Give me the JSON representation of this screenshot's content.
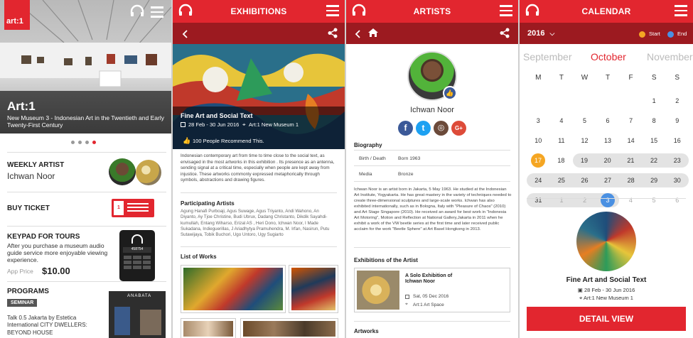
{
  "home": {
    "logo": "art:1",
    "hero_title": "Art:1",
    "hero_sub": "New Museum 3 - Indonesian Art in the Twentieth and Early Twenty-First Century",
    "weekly_label": "WEEKLY ARTIST",
    "weekly_name": "Ichwan Noor",
    "buy_ticket": "BUY TICKET",
    "keypad_title": "KEYPAD FOR TOURS",
    "keypad_desc": "After you purchase a museum audio guide service more enjoyable viewing experience.",
    "app_price_label": "App Price",
    "app_price": "$10.00",
    "phone_code": "458754",
    "programs": "PROGRAMS",
    "seminar": "SEMINAR",
    "program_text": "Talk 0.5 Jakarta by Estetica International CITY DWELLERS: BEYOND HOUSE",
    "poster_text": "ANABATA"
  },
  "exhibitions": {
    "title": "EXHIBITIONS",
    "ex_title": "Fine Art and Social Text",
    "date": "28 Feb - 30 Jun 2016",
    "place": "Art:1 New Museum 1",
    "recommend": "100 People Recommend This.",
    "desc": "Indonesian contemporary art from time to time close to the social text, as envisaged in the most artworks in this exhibition . Its presence as an antenna, sending signal at a critical time, especially when people are kept away from injustice. These artworks commonly expressed metaphorically through symbols, abstractions and drawing figures.",
    "participating_label": "Participating Artists",
    "artists": "Agung Hanafi Purboaji, Agus Suwage, Agus Triyanto, Andi Wahono, An Diyanto, Ay Tjoe Christine, Budi Ubrux, Dadang Christanto, Dikdik Sayahdi-kumullah, Entang Wiharso, Erizal AS , Heri Dono, Ichwan Noor, I Made Sukadana, Indieguerillas, J Ariadhytya Pramuhendra, M. Irfan, Nasirun, Putu Sutawijaya, Tobik Buchori, Ugo Untoro, Ugy Sugiarto",
    "works_label": "List of Works"
  },
  "artists": {
    "title": "ARTISTS",
    "name": "Ichwan Noor",
    "bio_label": "Biography",
    "birth_label": "Birth / Death",
    "birth_value": "Born 1963",
    "media_label": "Media",
    "media_value": "Bronze",
    "bio": "Ichwan Noor is an artist born in Jakarta, 5 May 1963. He studied at the Indonesian Art Institute, Yogyakarta. He has great mastery in the variety of techniques needed to create three-dimensional sculptures and large-scale works. Ichwan has also exhibited internationally, such as in Bologna, Italy with \"Pleasure of Chaos\" (2010) and Art Stage Singapore (2010). He received an award for best work in \"Indonesia Art Motoring\", Motion and Reflection at National Gallery,Jakarta in 2011 when he exhibit a work of the VW beetle series at the first time and later received public acclaim for the work \"Beetle Sphere\" at Art Basel Hongkong in 2013.",
    "exhib_label": "Exhibitions of the Artist",
    "exhib_title": "A Solo Exhibition of Ichwan Noor",
    "exhib_date": "Sat, 05 Dec 2016",
    "exhib_place": "Art:1 Art Space",
    "artworks_label": "Artworks",
    "social": {
      "fb": "f",
      "tw": "t",
      "ig": "◎",
      "gp": "G+"
    }
  },
  "calendar": {
    "title": "CALENDAR",
    "year": "2016",
    "start_label": "Start",
    "end_label": "End",
    "prev_month": "September",
    "month": "October",
    "next_month": "November",
    "weekdays": [
      "M",
      "T",
      "W",
      "T",
      "F",
      "S",
      "S"
    ],
    "weeks": [
      {
        "days": [
          "",
          "",
          "",
          "",
          "",
          "1",
          "2"
        ],
        "band": false
      },
      {
        "days": [
          "3",
          "4",
          "5",
          "6",
          "7",
          "8",
          "9"
        ],
        "band": false
      },
      {
        "days": [
          "10",
          "11",
          "12",
          "13",
          "14",
          "15",
          "16"
        ],
        "band": false
      },
      {
        "days": [
          "17",
          "18",
          "19",
          "20",
          "21",
          "22",
          "23"
        ],
        "band": false
      },
      {
        "days": [
          "24",
          "25",
          "26",
          "27",
          "28",
          "29",
          "30"
        ],
        "band": false
      },
      {
        "days": [
          "31",
          "1",
          "2",
          "3",
          "4",
          "5",
          "6"
        ],
        "band": false
      }
    ],
    "rows": [
      [
        "",
        "",
        "",
        "",
        "",
        "1",
        "2"
      ],
      [
        "3",
        "4",
        "5",
        "6",
        "7",
        "8",
        "9"
      ],
      [
        "10",
        "11",
        "12",
        "13",
        "14",
        "15",
        "16"
      ],
      [
        "17",
        "18",
        "19",
        "20",
        "21",
        "22",
        "23"
      ],
      [
        "24",
        "25",
        "26",
        "27",
        "28",
        "29",
        "30"
      ],
      [
        "31",
        "1",
        "2",
        "3",
        "4",
        "5",
        "6"
      ]
    ],
    "ev_title": "Fine Art and Social Text",
    "ev_date": "28 Feb - 30 Jun 2016",
    "ev_place": "Art:1 New Museum 1",
    "detail_btn": "DETAIL VIEW",
    "colors": {
      "start": "#f5a623",
      "end": "#4a90e2"
    }
  }
}
